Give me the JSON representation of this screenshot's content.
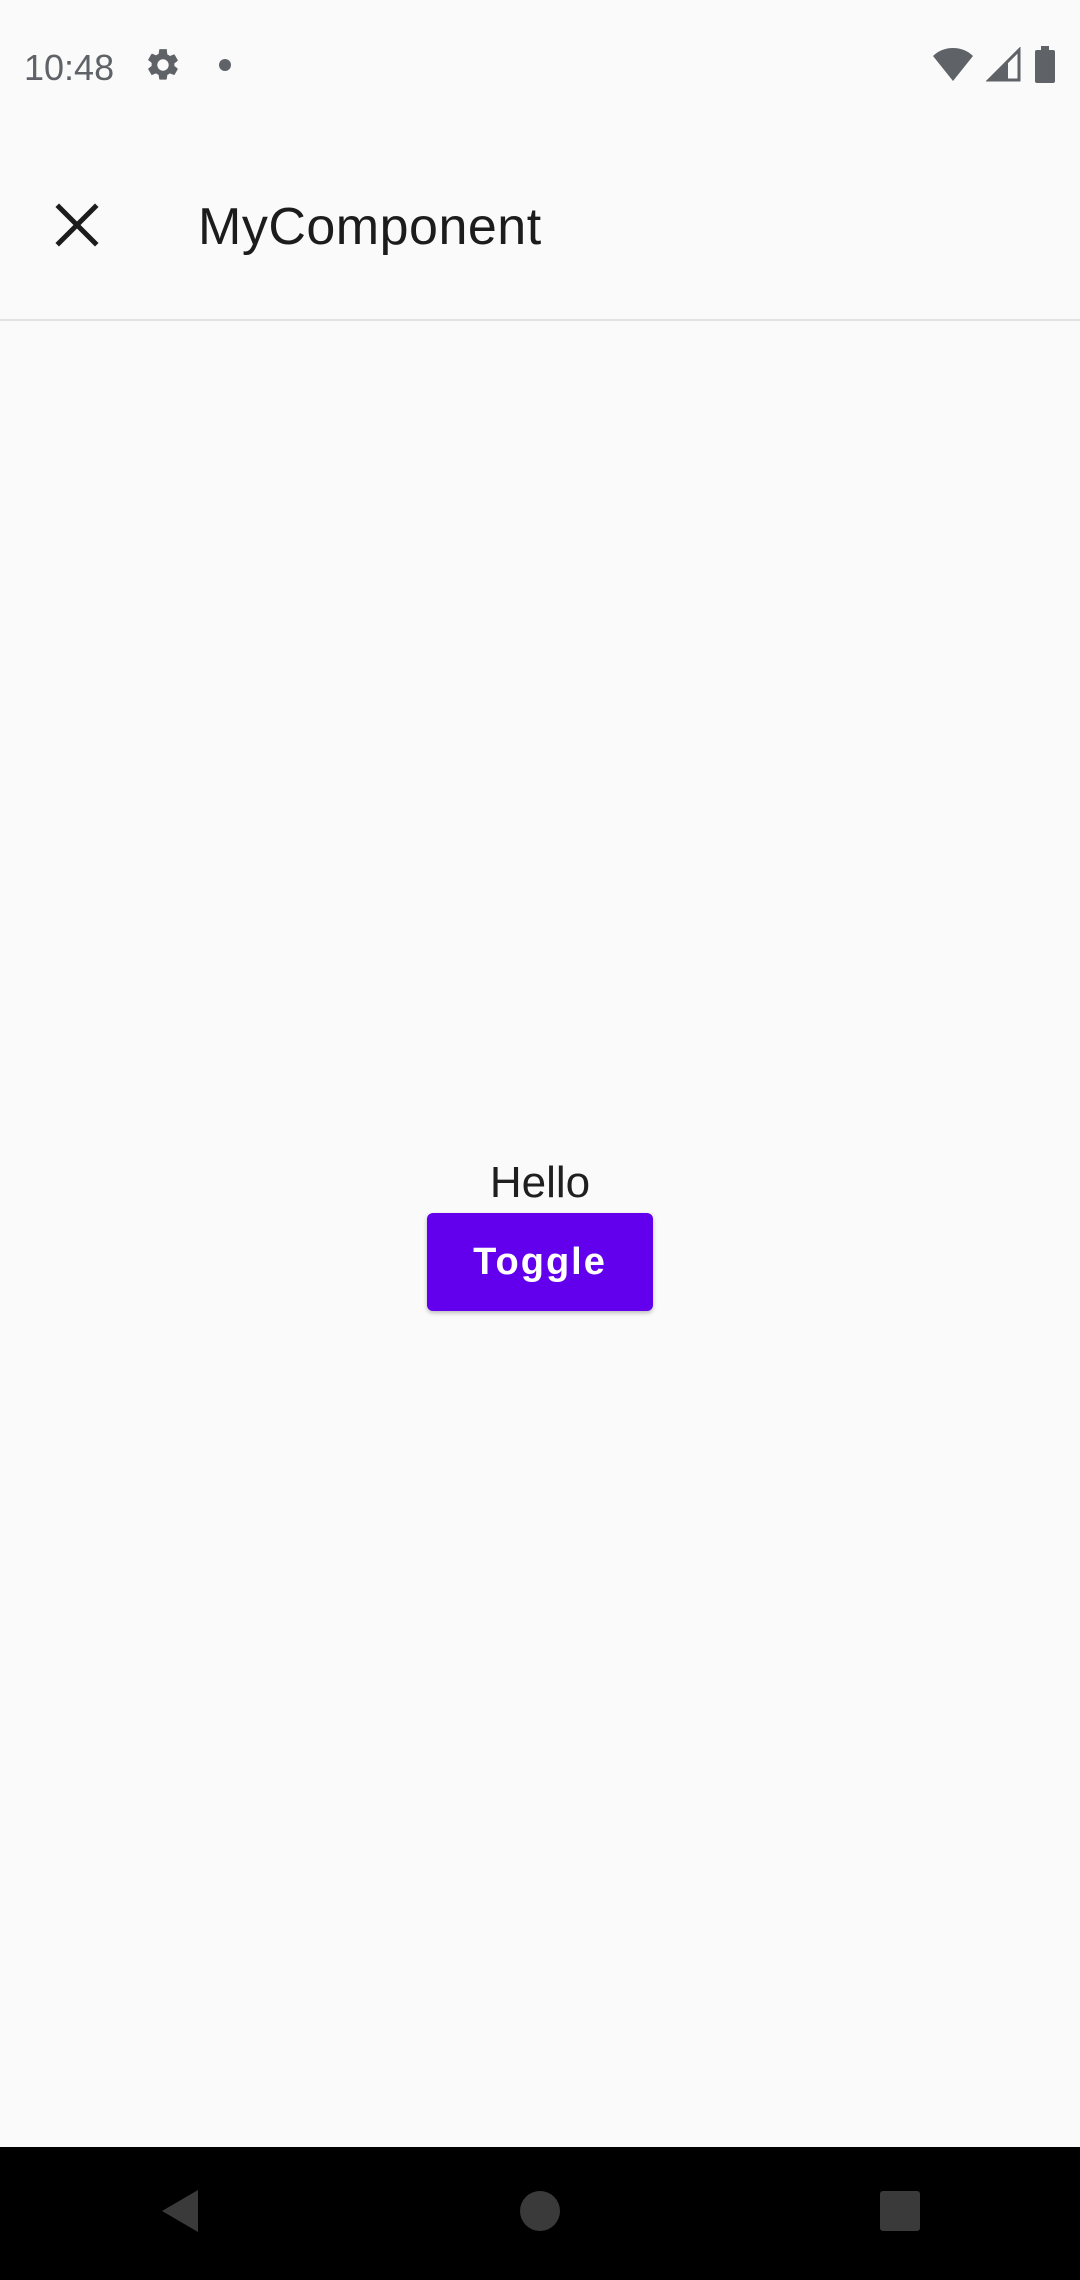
{
  "status_bar": {
    "time": "10:48",
    "icons": [
      "settings-icon",
      "notification-dot-icon",
      "wifi-icon",
      "signal-icon",
      "battery-icon"
    ]
  },
  "app_bar": {
    "title": "MyComponent",
    "close_icon": "close-icon"
  },
  "main": {
    "greeting": "Hello",
    "toggle_label": "Toggle"
  },
  "nav_bar": {
    "icons": [
      "back-icon",
      "home-icon",
      "recents-icon"
    ]
  },
  "colors": {
    "accent": "#6200ee",
    "background": "#fafafa",
    "nav_background": "#000000"
  }
}
